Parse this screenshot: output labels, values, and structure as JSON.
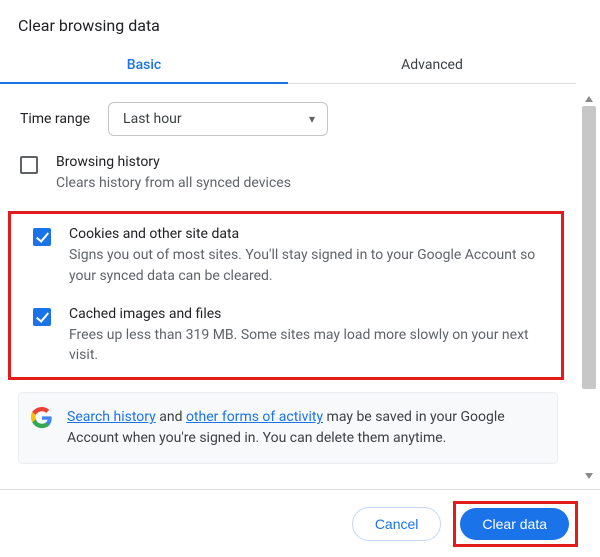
{
  "title": "Clear browsing data",
  "tabs": {
    "basic": "Basic",
    "advanced": "Advanced"
  },
  "time_range": {
    "label": "Time range",
    "value": "Last hour"
  },
  "options": {
    "browsing_history": {
      "title": "Browsing history",
      "desc": "Clears history from all synced devices",
      "checked": false
    },
    "cookies": {
      "title": "Cookies and other site data",
      "desc": "Signs you out of most sites. You'll stay signed in to your Google Account so your synced data can be cleared.",
      "checked": true
    },
    "cached": {
      "title": "Cached images and files",
      "desc": "Frees up less than 319 MB. Some sites may load more slowly on your next visit.",
      "checked": true
    }
  },
  "notice": {
    "link1": "Search history",
    "mid1": " and ",
    "link2": "other forms of activity",
    "rest": " may be saved in your Google Account when you're signed in. You can delete them anytime."
  },
  "buttons": {
    "cancel": "Cancel",
    "clear": "Clear data"
  }
}
